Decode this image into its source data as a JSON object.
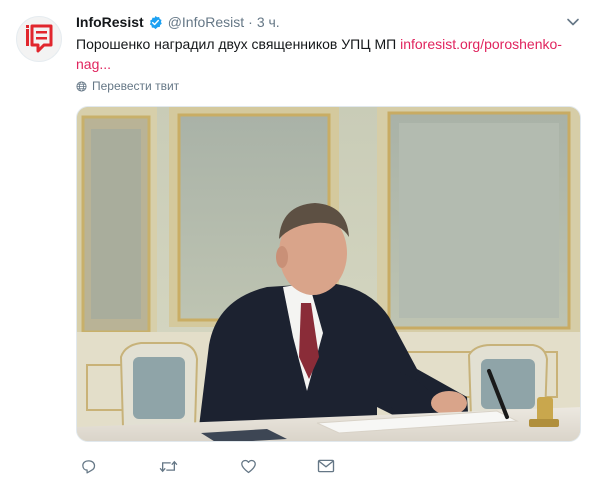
{
  "tweet": {
    "author_name": "InfoResist",
    "author_handle": "@InfoResist",
    "separator": "·",
    "time": "3 ч.",
    "text_plain": "Порошенко наградил двух священников УПЦ МП ",
    "link_line1": "inforesist.org/poroshenko-",
    "link_line2": "nag...",
    "translate_label": "Перевести твит"
  },
  "icons": {
    "avatar": "inforesist-logo",
    "verified": "verified-badge-icon",
    "menu": "chevron-down-icon",
    "translate": "globe-icon",
    "reply": "reply-icon",
    "retweet": "retweet-icon",
    "like": "heart-icon",
    "message": "envelope-icon"
  },
  "colors": {
    "accent": "#e0245e",
    "verified": "#1da1f2",
    "secondary_text": "#657786",
    "logo_red": "#e1262d"
  }
}
